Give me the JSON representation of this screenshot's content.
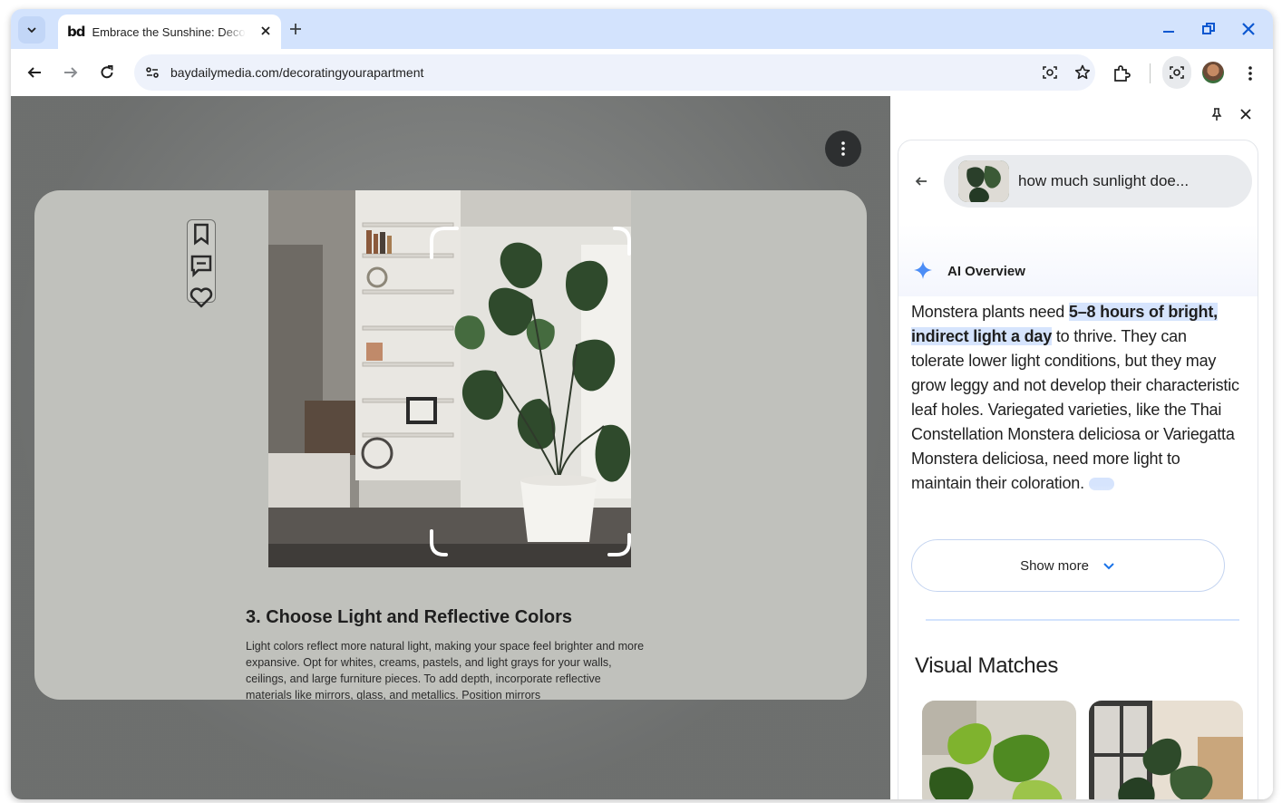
{
  "browser": {
    "tab": {
      "favicon_text": "bd",
      "title": "Embrace the Sunshine: Decorating Your Apartment"
    },
    "url": "baydailymedia.com/decoratingyourapartment"
  },
  "article": {
    "heading": "3. Choose Light and Reflective Colors",
    "body": "Light colors reflect more natural light, making your space feel brighter and more expansive. Opt for whites, creams, pastels, and light grays for your walls, ceilings, and large furniture pieces. To add depth, incorporate reflective materials like mirrors, glass, and metallics. Position mirrors"
  },
  "panel": {
    "search_query": "how much sunlight doe...",
    "ai_overview": {
      "title": "AI Overview",
      "text_before": "Monstera plants need ",
      "highlight": "5–8 hours of bright, indirect light a day",
      "text_after": " to thrive. They can tolerate lower light conditions, but they may grow leggy and not develop their characteristic leaf holes. Variegated varieties, like the Thai Constellation Monstera deliciosa or Variegatta Monstera deliciosa, need more light to maintain their coloration."
    },
    "show_more_label": "Show more",
    "visual_matches_title": "Visual Matches"
  },
  "icons": [
    "tab-search-icon",
    "close-icon",
    "plus-icon",
    "minimize-icon",
    "restore-icon",
    "back-icon",
    "forward-icon",
    "reload-icon",
    "site-info-icon",
    "lens-icon",
    "star-icon",
    "extensions-icon",
    "more-vert-icon",
    "pin-icon",
    "bookmark-icon",
    "comment-icon",
    "heart-icon",
    "sparkle-icon",
    "chevron-down-icon"
  ],
  "colors": {
    "tab_strip": "#d3e3fd",
    "highlight": "#d6e4fd",
    "accent_blue": "#1a73e8"
  }
}
